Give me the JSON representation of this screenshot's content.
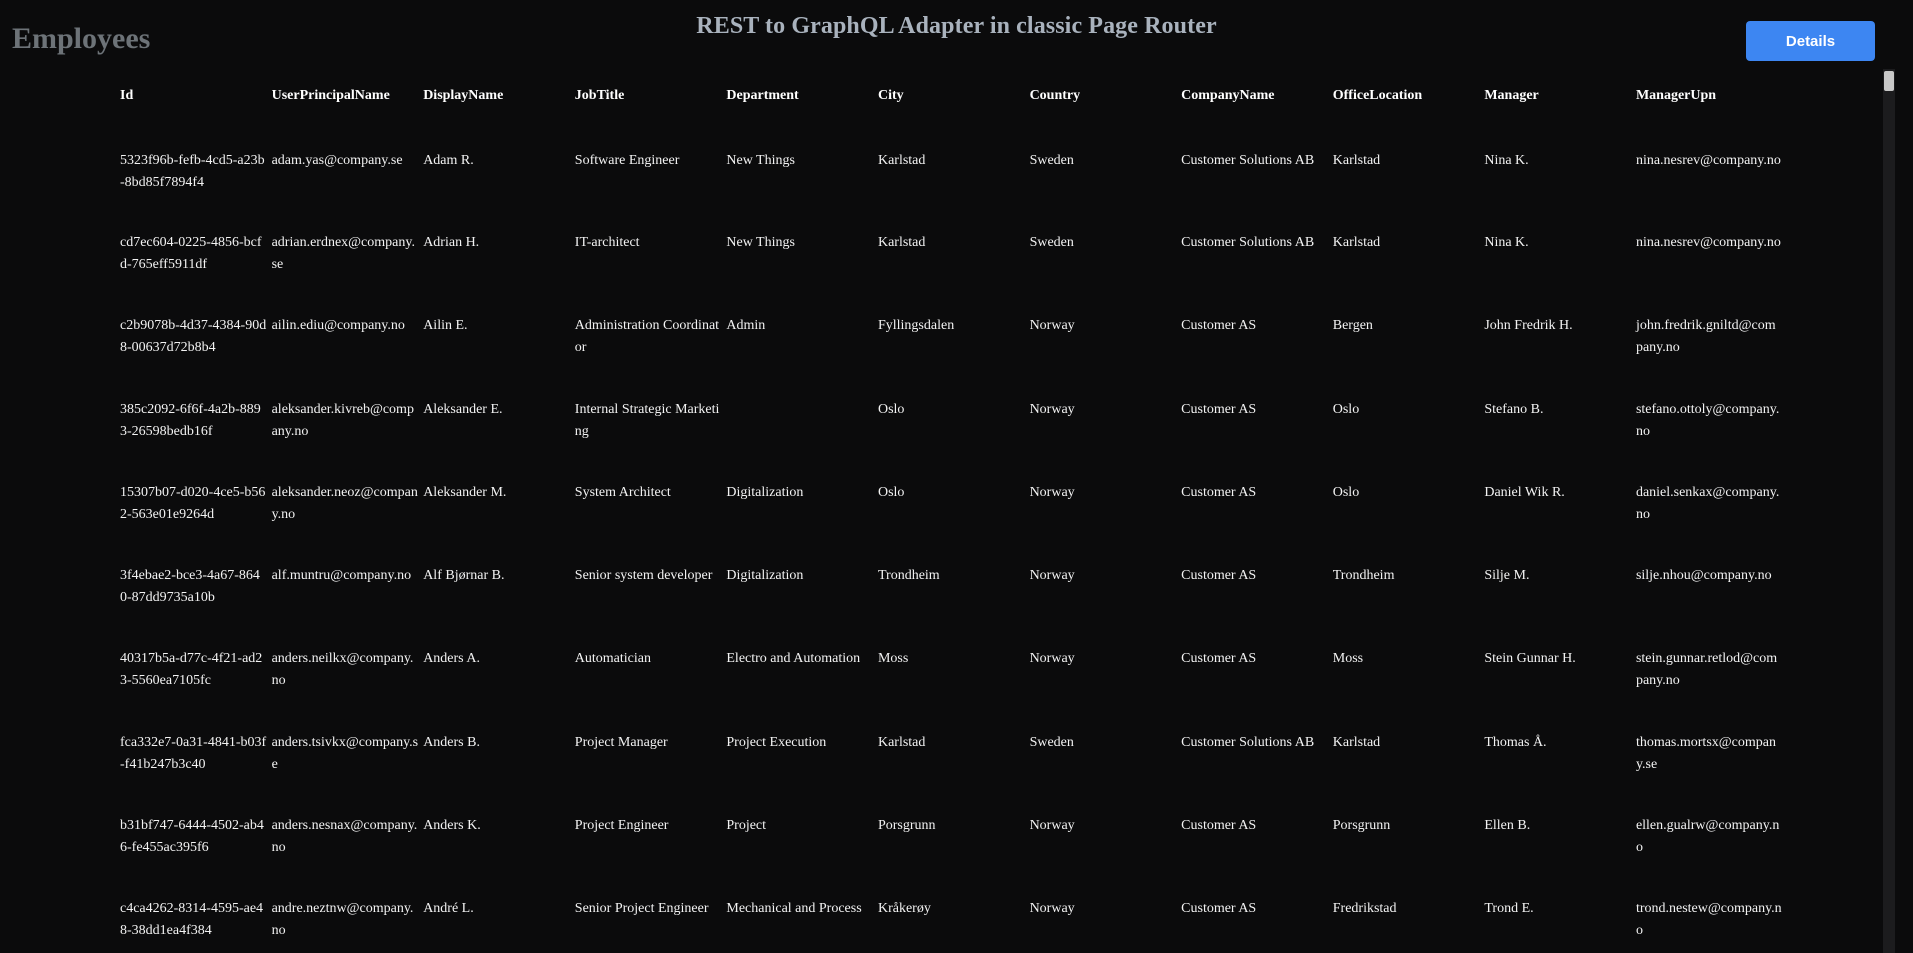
{
  "header": {
    "title": "REST to GraphQL Adapter in classic Page Router",
    "heading": "Employees",
    "details_label": "Details"
  },
  "table": {
    "columns": [
      "Id",
      "UserPrincipalName",
      "DisplayName",
      "JobTitle",
      "Department",
      "City",
      "Country",
      "CompanyName",
      "OfficeLocation",
      "Manager",
      "ManagerUpn"
    ],
    "rows": [
      [
        "5323f96b-fefb-4cd5-a23b-8bd85f7894f4",
        "adam.yas@company.se",
        "Adam R.",
        "Software Engineer",
        "New Things",
        "Karlstad",
        "Sweden",
        "Customer Solutions AB",
        "Karlstad",
        "Nina K.",
        "nina.nesrev@company.no"
      ],
      [
        "cd7ec604-0225-4856-bcfd-765eff5911df",
        "adrian.erdnex@company.se",
        "Adrian H.",
        "IT-architect",
        "New Things",
        "Karlstad",
        "Sweden",
        "Customer Solutions AB",
        "Karlstad",
        "Nina K.",
        "nina.nesrev@company.no"
      ],
      [
        "c2b9078b-4d37-4384-90d8-00637d72b8b4",
        "ailin.ediu@company.no",
        "Ailin E.",
        "Administration Coordinator",
        "Admin",
        "Fyllingsdalen",
        "Norway",
        "Customer AS",
        "Bergen",
        "John Fredrik H.",
        "john.fredrik.gniltd@company.no"
      ],
      [
        "385c2092-6f6f-4a2b-8893-26598bedb16f",
        "aleksander.kivreb@company.no",
        "Aleksander E.",
        "Internal Strategic Marketing",
        "",
        "Oslo",
        "Norway",
        "Customer AS",
        "Oslo",
        "Stefano B.",
        "stefano.ottoly@company.no"
      ],
      [
        "15307b07-d020-4ce5-b562-563e01e9264d",
        "aleksander.neoz@company.no",
        "Aleksander M.",
        "System Architect",
        "Digitalization",
        "Oslo",
        "Norway",
        "Customer AS",
        "Oslo",
        "Daniel Wik R.",
        "daniel.senkax@company.no"
      ],
      [
        "3f4ebae2-bce3-4a67-8640-87dd9735a10b",
        "alf.muntru@company.no",
        "Alf Bjørnar B.",
        "Senior system developer",
        "Digitalization",
        "Trondheim",
        "Norway",
        "Customer AS",
        "Trondheim",
        "Silje M.",
        "silje.nhou@company.no"
      ],
      [
        "40317b5a-d77c-4f21-ad23-5560ea7105fc",
        "anders.neilkx@company.no",
        "Anders A.",
        "Automatician",
        "Electro and Automation",
        "Moss",
        "Norway",
        "Customer AS",
        "Moss",
        "Stein Gunnar H.",
        "stein.gunnar.retlod@company.no"
      ],
      [
        "fca332e7-0a31-4841-b03f-f41b247b3c40",
        "anders.tsivkx@company.se",
        "Anders B.",
        "Project Manager",
        "Project Execution",
        "Karlstad",
        "Sweden",
        "Customer Solutions AB",
        "Karlstad",
        "Thomas Å.",
        "thomas.mortsx@company.se"
      ],
      [
        "b31bf747-6444-4502-ab46-fe455ac395f6",
        "anders.nesnax@company.no",
        "Anders K.",
        "Project Engineer",
        "Project",
        "Porsgrunn",
        "Norway",
        "Customer AS",
        "Porsgrunn",
        "Ellen B.",
        "ellen.gualrw@company.no"
      ],
      [
        "c4ca4262-8314-4595-ae48-38dd1ea4f384",
        "andre.neztnw@company.no",
        "André L.",
        "Senior Project Engineer",
        "Mechanical and Process",
        "Kråkerøy",
        "Norway",
        "Customer AS",
        "Fredrikstad",
        "Trond E.",
        "trond.nestew@company.no"
      ]
    ]
  }
}
